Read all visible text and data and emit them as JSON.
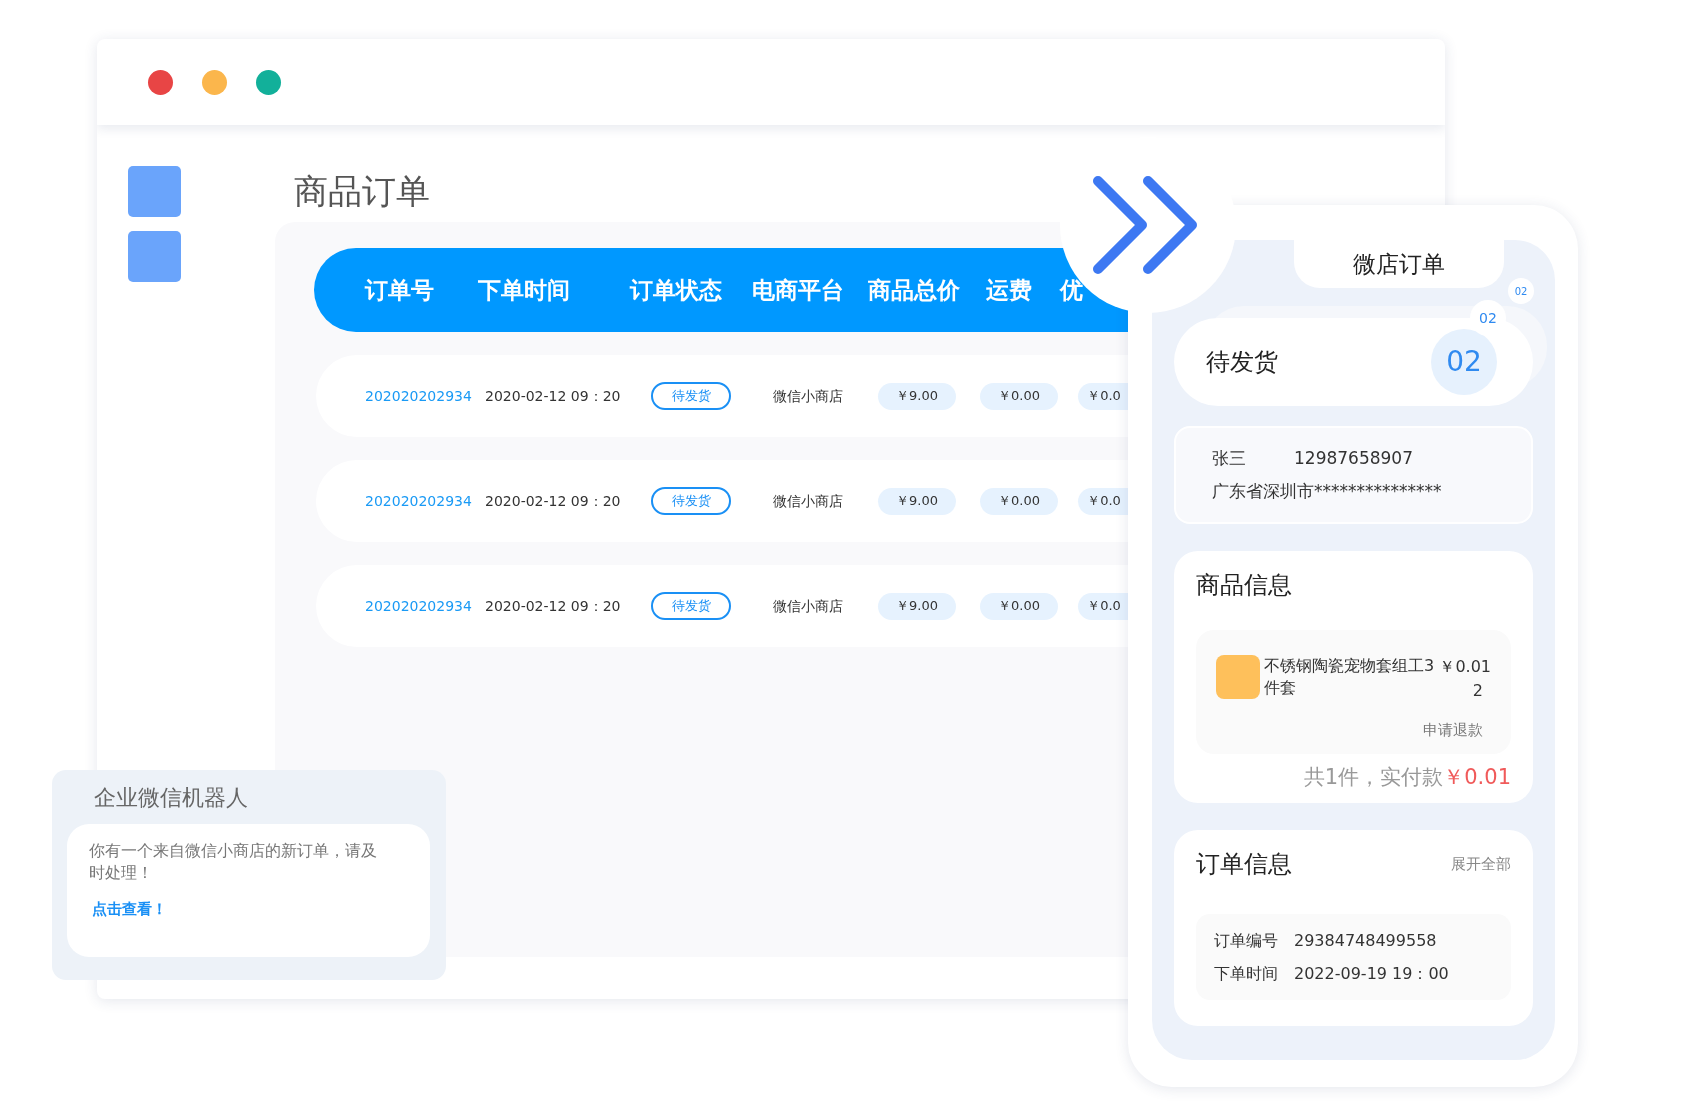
{
  "window": {
    "traffic_lights": [
      {
        "color": "#e84545"
      },
      {
        "color": "#fbb64c"
      },
      {
        "color": "#12b09a"
      }
    ]
  },
  "page_title": "商品订单",
  "table": {
    "columns": [
      "订单号",
      "下单时间",
      "订单状态",
      "电商平台",
      "商品总价",
      "运费",
      "优"
    ],
    "rows": [
      {
        "order_no": "202020202934",
        "time": "2020-02-12 09：20",
        "status": "待发货",
        "platform": "微信小商店",
        "total": "￥9.00",
        "shipping": "￥0.00",
        "column_7": "￥0.0"
      },
      {
        "order_no": "202020202934",
        "time": "2020-02-12 09：20",
        "status": "待发货",
        "platform": "微信小商店",
        "total": "￥9.00",
        "shipping": "￥0.00",
        "column_7": "￥0.0"
      },
      {
        "order_no": "202020202934",
        "time": "2020-02-12 09：20",
        "status": "待发货",
        "platform": "微信小商店",
        "total": "￥9.00",
        "shipping": "￥0.00",
        "column_7": "￥0.0"
      }
    ]
  },
  "phone": {
    "title": "微店订单",
    "status": {
      "label": "待发货",
      "count": "02",
      "badges": [
        "02",
        "02"
      ]
    },
    "address": {
      "name": "张三",
      "phone": "12987658907",
      "address": "广东省深圳市***************"
    },
    "goods": {
      "title": "商品信息",
      "item": {
        "name": "不锈钢陶瓷宠物套组工3件套",
        "price": "￥0.01",
        "quantity": "2",
        "action": "申请退款"
      },
      "summary": "共1件，实付款",
      "paid": "￥0.01"
    },
    "order": {
      "title": "订单信息",
      "expand": "展开全部",
      "fields": [
        {
          "label": "订单编号",
          "value": "29384748499558"
        },
        {
          "label": "下单时间",
          "value": "2022-09-19  19：00"
        }
      ]
    }
  },
  "robot": {
    "title": "企业微信机器人",
    "message": "你有一个来自微信小商店的新订单，请及时处理！",
    "link": "点击查看！"
  }
}
